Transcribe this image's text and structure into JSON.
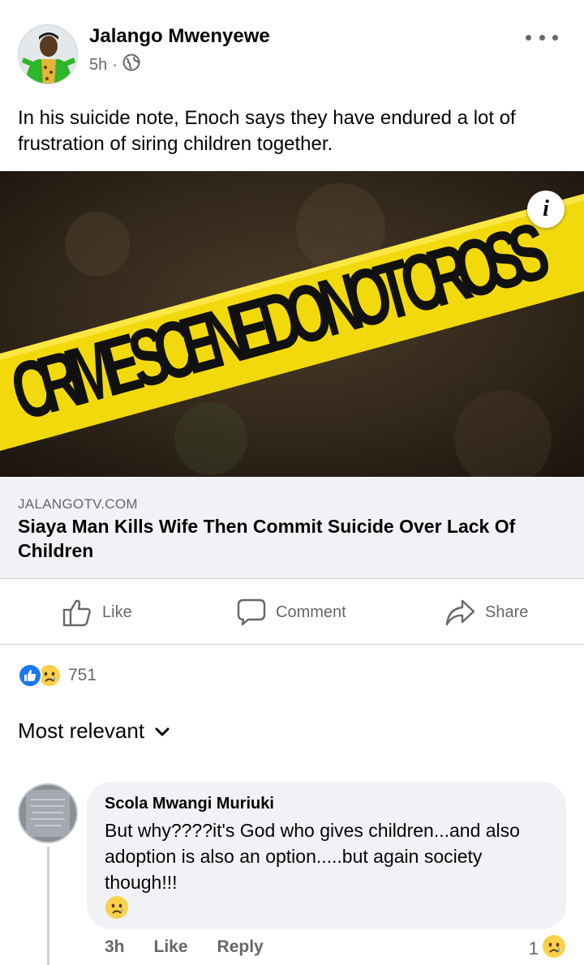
{
  "post": {
    "author": "Jalango Mwenyewe",
    "time": "5h",
    "separator": "·",
    "privacy_icon": "globe-icon",
    "more_icon": "more-dots-icon",
    "text": "In his suicide note, Enoch says they have endured a lot of frustration of siring children together."
  },
  "link": {
    "image_text": "CRIME SCENE DO NOT CROSS",
    "info_icon": "i",
    "domain": "JALANGOTV.COM",
    "title": "Siaya Man Kills Wife Then Commit Suicide Over Lack Of Children"
  },
  "actions": {
    "like": "Like",
    "comment": "Comment",
    "share": "Share"
  },
  "reactions": {
    "types": [
      "like-reaction-icon",
      "sad-reaction-icon"
    ],
    "count": "751"
  },
  "sort": {
    "label": "Most relevant",
    "icon": "chevron-down-icon"
  },
  "comments": [
    {
      "author": "Scola Mwangi Muriuki",
      "text": "But why????it's God who gives children...and also  adoption is also an option.....but again society though!!!",
      "emoji": "sad-face-emoji",
      "time": "3h",
      "like": "Like",
      "reply": "Reply",
      "reaction_count": "1",
      "reaction_icon": "sad-reaction-icon"
    }
  ],
  "colors": {
    "text": "#050505",
    "secondary": "#65676b",
    "bubble": "#f0f2f5",
    "like_blue": "#1877f2",
    "tape_yellow": "#f2d90c",
    "tape_text": "#111111"
  }
}
